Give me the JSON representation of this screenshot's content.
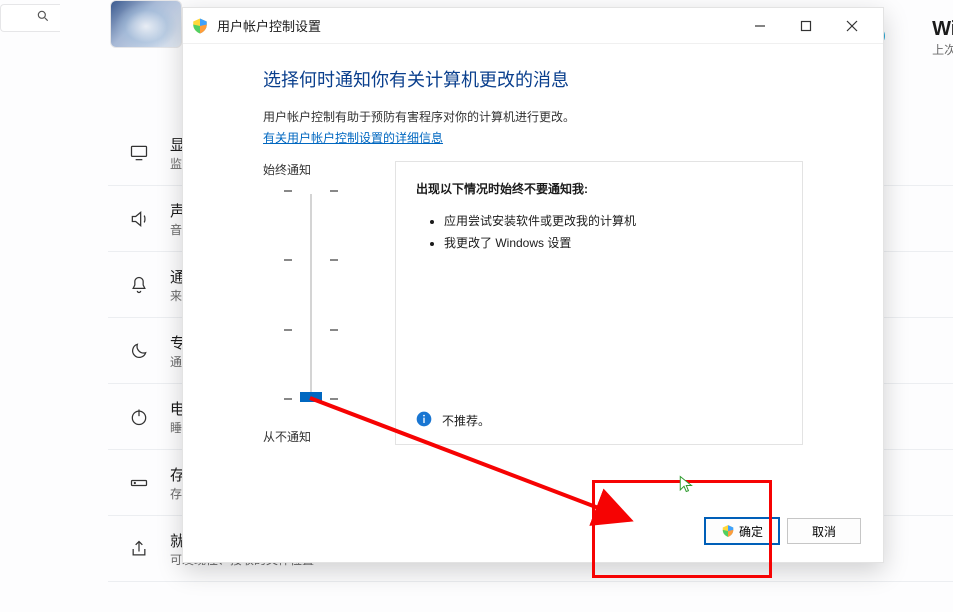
{
  "colors": {
    "accent": "#0067c0",
    "annotation": "#f60303"
  },
  "bg": {
    "right_head_title": "Windo",
    "right_head_sub": "上次检查",
    "items": [
      {
        "title": "显",
        "sub": "监"
      },
      {
        "title": "声",
        "sub": "音"
      },
      {
        "title": "通",
        "sub": "来"
      },
      {
        "title": "专",
        "sub": "通"
      },
      {
        "title": "电",
        "sub": "睡"
      },
      {
        "title": "存",
        "sub": "存"
      },
      {
        "title": "就近共享",
        "sub": "可发现性、接收的文件位置"
      }
    ]
  },
  "dialog": {
    "title": "用户帐户控制设置",
    "heading": "选择何时通知你有关计算机更改的消息",
    "desc": "用户帐户控制有助于预防有害程序对你的计算机进行更改。",
    "link": "有关用户帐户控制设置的详细信息",
    "slider_top": "始终通知",
    "slider_bottom": "从不通知",
    "card_heading": "出现以下情况时始终不要通知我:",
    "card_items": [
      "应用尝试安装软件或更改我的计算机",
      "我更改了 Windows 设置"
    ],
    "card_note": "不推荐。",
    "ok": "确定",
    "cancel": "取消"
  },
  "icons": {
    "shield": "uac-shield-icon",
    "info": "info-icon",
    "search": "search-icon"
  }
}
